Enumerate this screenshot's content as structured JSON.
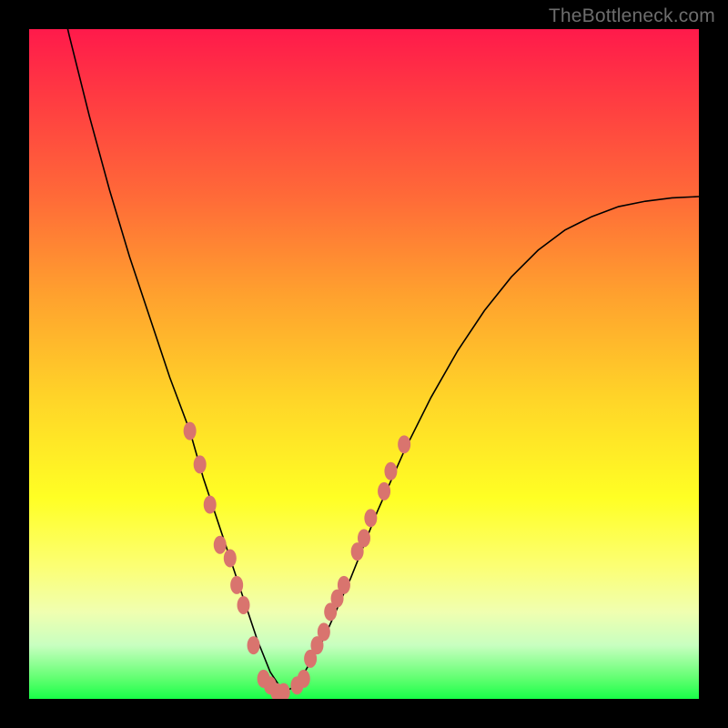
{
  "brand": {
    "watermark": "TheBottleneck.com"
  },
  "chart_data": {
    "type": "line",
    "title": "",
    "xlabel": "",
    "ylabel": "",
    "xlim": [
      0,
      100
    ],
    "ylim": [
      0,
      100
    ],
    "grid": false,
    "legend": null,
    "background": {
      "type": "vertical-gradient",
      "stops": [
        {
          "pos": 0,
          "color": "#ff1a4b"
        },
        {
          "pos": 25,
          "color": "#ff6a38"
        },
        {
          "pos": 55,
          "color": "#ffd428"
        },
        {
          "pos": 80,
          "color": "#fcff72"
        },
        {
          "pos": 100,
          "color": "#18ff48"
        }
      ]
    },
    "series": [
      {
        "name": "bottleneck-curve",
        "x": [
          0,
          3,
          6,
          9,
          12,
          15,
          18,
          21,
          24,
          26,
          28,
          30,
          32,
          34,
          36,
          38,
          40,
          44,
          48,
          52,
          56,
          60,
          64,
          68,
          72,
          76,
          80,
          84,
          88,
          92,
          96,
          100
        ],
        "values": [
          126,
          112,
          99,
          87,
          76,
          66,
          57,
          48,
          40,
          33,
          27,
          21,
          15,
          9,
          4,
          1,
          2,
          9,
          18,
          28,
          37,
          45,
          52,
          58,
          63,
          67,
          70,
          72,
          73.5,
          74.3,
          74.8,
          75
        ]
      }
    ],
    "markers": {
      "name": "highlighted-points",
      "color": "#d9746e",
      "points": [
        {
          "x": 24,
          "y": 40
        },
        {
          "x": 25.5,
          "y": 35
        },
        {
          "x": 27,
          "y": 29
        },
        {
          "x": 28.5,
          "y": 23
        },
        {
          "x": 30,
          "y": 21
        },
        {
          "x": 31,
          "y": 17
        },
        {
          "x": 32,
          "y": 14
        },
        {
          "x": 33.5,
          "y": 8
        },
        {
          "x": 35,
          "y": 3
        },
        {
          "x": 36,
          "y": 2
        },
        {
          "x": 37,
          "y": 1
        },
        {
          "x": 38,
          "y": 1
        },
        {
          "x": 40,
          "y": 2
        },
        {
          "x": 41,
          "y": 3
        },
        {
          "x": 42,
          "y": 6
        },
        {
          "x": 43,
          "y": 8
        },
        {
          "x": 44,
          "y": 10
        },
        {
          "x": 45,
          "y": 13
        },
        {
          "x": 46,
          "y": 15
        },
        {
          "x": 47,
          "y": 17
        },
        {
          "x": 49,
          "y": 22
        },
        {
          "x": 50,
          "y": 24
        },
        {
          "x": 51,
          "y": 27
        },
        {
          "x": 53,
          "y": 31
        },
        {
          "x": 54,
          "y": 34
        },
        {
          "x": 56,
          "y": 38
        }
      ]
    }
  }
}
